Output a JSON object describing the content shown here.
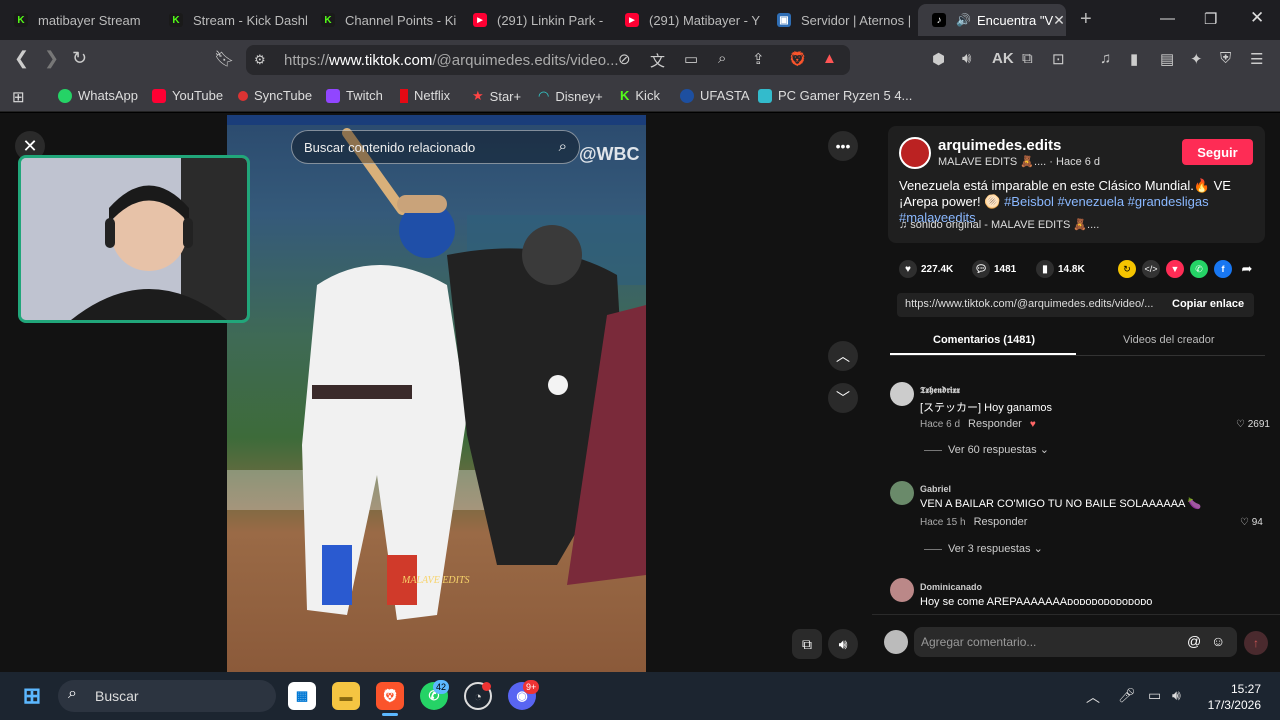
{
  "browser": {
    "tabs": [
      {
        "label": "matibayer Stream",
        "icon": "kick-icon"
      },
      {
        "label": "Stream - Kick Dashb",
        "icon": "kick-icon"
      },
      {
        "label": "Channel Points - Ki",
        "icon": "kick-icon"
      },
      {
        "label": "(291) Linkin Park - ",
        "icon": "youtube-icon"
      },
      {
        "label": "(291) Matibayer - Y",
        "icon": "youtube-icon"
      },
      {
        "label": "Servidor | Aternos |",
        "icon": "aternos-icon"
      },
      {
        "label": "Encuentra \"V",
        "icon": "tiktok-icon"
      }
    ],
    "url_prefix": "https://",
    "url_host": "www.tiktok.com",
    "url_path": "/@arquimedes.edits/video...",
    "bookmarks": [
      "WhatsApp",
      "YouTube",
      "SyncTube",
      "Twitch",
      "Netflix",
      "Star+",
      "Disney+",
      "Kick",
      "UFASTA",
      "PC Gamer Ryzen 5 4..."
    ]
  },
  "video": {
    "search_placeholder": "Buscar contenido relacionado",
    "watermark": "@WBC",
    "edit_watermark": "MALAVE EDITS"
  },
  "post": {
    "username": "arquimedes.edits",
    "subtitle": "MALAVE EDITS 🧸.... · Hace 6 d",
    "follow_label": "Seguir",
    "description": "Venezuela está imparable en este Clásico Mundial.🔥 VE ¡Arepa power! 🫓",
    "hashtags": "#Beisbol #venezuela #grandesligas #malaveedits",
    "music": "♫  sonido original - MALAVE EDITS 🧸....",
    "likes": "227.4K",
    "comments": "1481",
    "saves": "14.8K",
    "link": "https://www.tiktok.com/@arquimedes.edits/video/...",
    "copy_label": "Copiar enlace"
  },
  "tabs": {
    "comments": "Comentarios (1481)",
    "creator_videos": "Videos del creador"
  },
  "comments": [
    {
      "name": "𝕿𝖝𝖍𝖊𝖓𝖉𝖗𝖎𝖝𝖝",
      "text": "[ステッカー] Hoy ganamos",
      "time": "Hace 6 d",
      "reply": "Responder",
      "likes": "2691",
      "replies": "Ver 60 respuestas ⌄"
    },
    {
      "name": "Gabriel",
      "text": "VEN A BAILAR CO'MIGO TU NO BAILE SOLAAAAAA 🍆",
      "time": "Hace 15 h",
      "reply": "Responder",
      "likes": "94",
      "replies": "Ver 3 respuestas ⌄"
    },
    {
      "name": "Dominicanado",
      "text": "Hoy se come AREPAAAAAAAᴅᴏᴅᴏᴅᴏᴅᴏᴅᴏᴅᴏᴅᴏ",
      "time": "",
      "reply": "",
      "likes": "",
      "replies": ""
    }
  ],
  "composer": {
    "placeholder": "Agregar comentario..."
  },
  "taskbar": {
    "search_label": "Buscar",
    "whatsapp_badge": "42",
    "discord_badge": "9+",
    "time": "15:27",
    "date": "17/3/2026"
  },
  "colors": {
    "follow": "#fe2c55",
    "hashtag": "#8ab8ff",
    "webcam_border": "#21a67a"
  }
}
